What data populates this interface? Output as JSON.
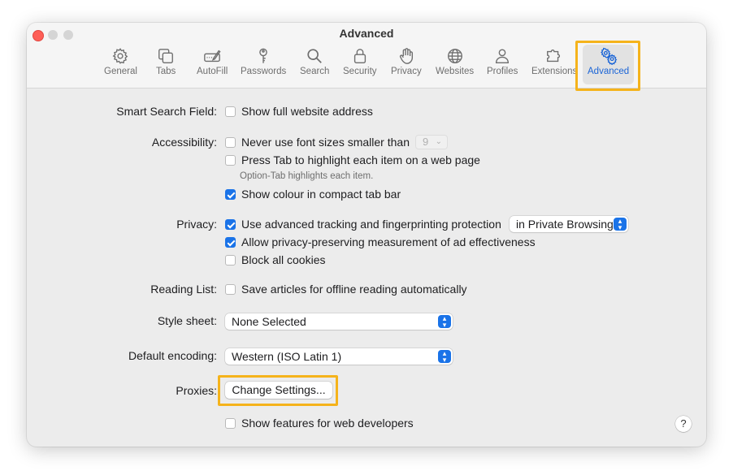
{
  "window": {
    "title": "Advanced"
  },
  "tabs": [
    {
      "label": "General",
      "icon": "gear-icon"
    },
    {
      "label": "Tabs",
      "icon": "tabs-icon"
    },
    {
      "label": "AutoFill",
      "icon": "autofill-icon"
    },
    {
      "label": "Passwords",
      "icon": "key-icon"
    },
    {
      "label": "Search",
      "icon": "search-icon"
    },
    {
      "label": "Security",
      "icon": "lock-icon"
    },
    {
      "label": "Privacy",
      "icon": "hand-icon"
    },
    {
      "label": "Websites",
      "icon": "globe-icon"
    },
    {
      "label": "Profiles",
      "icon": "person-icon"
    },
    {
      "label": "Extensions",
      "icon": "puzzle-icon"
    },
    {
      "label": "Advanced",
      "icon": "gears-icon",
      "active": true
    }
  ],
  "settings": {
    "smart_search": {
      "label": "Smart Search Field:",
      "option": "Show full website address",
      "checked": false
    },
    "accessibility": {
      "label": "Accessibility:",
      "font_option": "Never use font sizes smaller than",
      "font_size": "9",
      "font_checked": false,
      "tab_option": "Press Tab to highlight each item on a web page",
      "tab_checked": false,
      "tab_hint": "Option-Tab highlights each item.",
      "colour_option": "Show colour in compact tab bar",
      "colour_checked": true
    },
    "privacy": {
      "label": "Privacy:",
      "tracking_option": "Use advanced tracking and fingerprinting protection",
      "tracking_checked": true,
      "tracking_scope": "in Private Browsing",
      "ad_option": "Allow privacy-preserving measurement of ad effectiveness",
      "ad_checked": true,
      "cookies_option": "Block all cookies",
      "cookies_checked": false
    },
    "reading_list": {
      "label": "Reading List:",
      "option": "Save articles for offline reading automatically",
      "checked": false
    },
    "style_sheet": {
      "label": "Style sheet:",
      "value": "None Selected"
    },
    "encoding": {
      "label": "Default encoding:",
      "value": "Western (ISO Latin 1)"
    },
    "proxies": {
      "label": "Proxies:",
      "button": "Change Settings..."
    },
    "developer": {
      "option": "Show features for web developers",
      "checked": false
    },
    "help": "?"
  },
  "colors": {
    "accent": "#1a73e8",
    "highlight": "#f5b31b",
    "active_tab_text": "#1a64d6"
  }
}
